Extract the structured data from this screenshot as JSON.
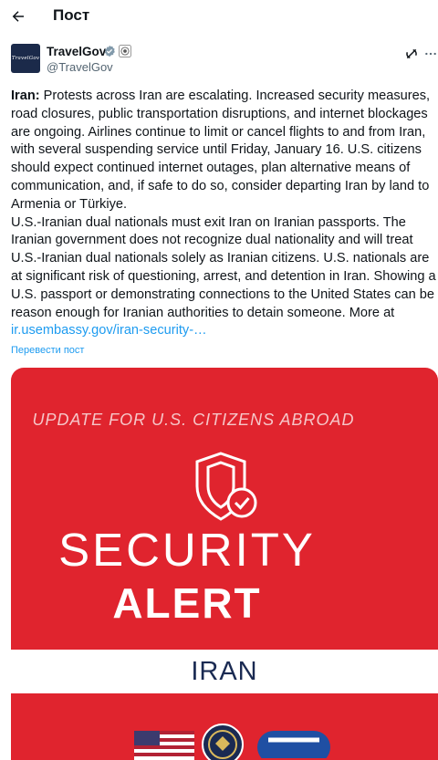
{
  "header": {
    "title": "Пост",
    "back_icon": "arrow-left-icon"
  },
  "author": {
    "name": "TravelGov",
    "handle": "@TravelGov",
    "avatar_text": "TravelGov",
    "verified_badge_color": "#829aab",
    "badge_icons": [
      "verified-badge-icon",
      "government-affiliation-icon"
    ]
  },
  "actions": {
    "grok_icon": "grok-icon",
    "more_icon": "more-icon"
  },
  "post": {
    "lead_bold": "Iran:",
    "paragraph_1": " Protests across Iran are escalating. Increased security measures, road closures, public transportation disruptions, and internet blockages are ongoing. Airlines continue to limit or cancel flights to and from Iran, with several suspending service until Friday, January 16. U.S. citizens should expect continued internet outages, plan alternative means of communication, and, if safe to do so, consider departing Iran by land to Armenia or Türkiye.",
    "paragraph_2": "U.S.-Iranian dual nationals must exit Iran on Iranian passports. The Iranian government does not recognize dual nationality and will treat U.S.-Iranian dual nationals solely as Iranian citizens. U.S. nationals are at significant risk of questioning, arrest, and detention in Iran. Showing a U.S. passport or demonstrating connections to the United States can be reason enough for Iranian authorities to detain someone. More at",
    "link_text": "ir.usembassy.gov/iran-security-…",
    "link_color": "#1d9bf0",
    "translate_label": "Перевести пост"
  },
  "media": {
    "background_color": "#e0242e",
    "headline_small": "UPDATE FOR U.S. CITIZENS ABROAD",
    "headline_line1": "SECURITY",
    "headline_line2": "ALERT",
    "country": "IRAN",
    "country_text_color": "#1a2a52",
    "icons": [
      "shield-check-icon",
      "us-flag-icon",
      "state-department-seal-icon",
      "step-logo-icon"
    ]
  }
}
